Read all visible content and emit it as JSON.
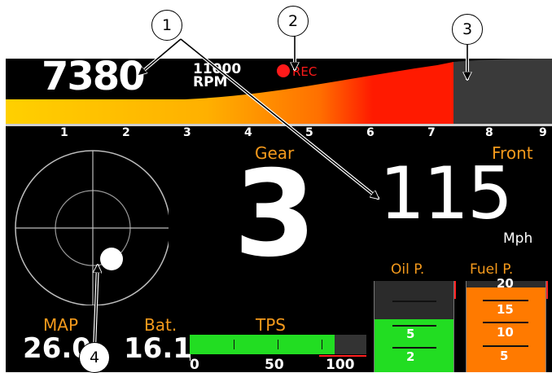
{
  "callouts": [
    "1",
    "2",
    "3",
    "4"
  ],
  "rpm": {
    "value": "7380",
    "max": "11000",
    "unit": "RPM",
    "rec_label": "REC",
    "fill_fraction": 0.82,
    "scale": [
      "1",
      "2",
      "3",
      "4",
      "5",
      "6",
      "7",
      "8",
      "9"
    ]
  },
  "gear": {
    "label": "Gear",
    "value": "3"
  },
  "speed": {
    "label": "Front",
    "value": "115",
    "unit": "Mph"
  },
  "map": {
    "label": "MAP",
    "value": "26.0"
  },
  "battery": {
    "label": "Bat.",
    "value": "16.1"
  },
  "tps": {
    "label": "TPS",
    "ticks": [
      "0",
      "50",
      "100"
    ],
    "fill_fraction": 0.82
  },
  "oil_pressure": {
    "label": "Oil P.",
    "scale": [
      "5",
      "2"
    ]
  },
  "fuel_pressure": {
    "label": "Fuel P.",
    "scale": [
      "20",
      "15",
      "10",
      "5"
    ]
  },
  "colors": {
    "accent": "#f59a1c",
    "rec": "#ff1a1a",
    "tps_fill": "#22dd22",
    "oil_fill": "#22dd22",
    "fuel_fill": "#ff7a00"
  },
  "icons": [
    "rec-dot-icon",
    "g-force-crosshair-icon"
  ]
}
